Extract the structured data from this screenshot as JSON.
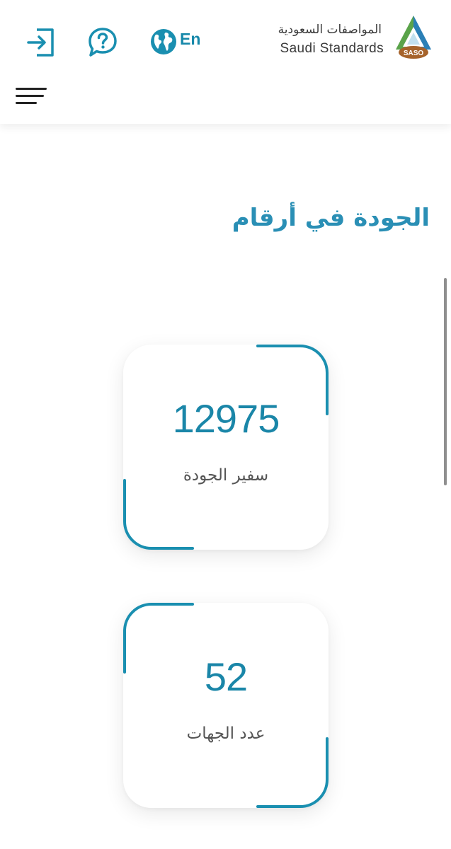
{
  "header": {
    "language_label": "En",
    "logo": {
      "arabic_name": "المواصفات السعودية",
      "english_name": "Saudi Standards",
      "badge": "SASO"
    }
  },
  "icons": [
    "login-icon",
    "help-icon",
    "globe-icon",
    "menu-icon"
  ],
  "section": {
    "title": "الجودة في أرقام"
  },
  "stats": [
    {
      "value": "12975",
      "label": "سفير الجودة"
    },
    {
      "value": "52",
      "label": "عدد الجهات"
    }
  ],
  "colors": {
    "accent": "#1a8fb0",
    "title": "#2a8fb5",
    "logo_green": "#5aa34a",
    "logo_blue": "#2a7fb6",
    "logo_brown": "#a6632b"
  }
}
